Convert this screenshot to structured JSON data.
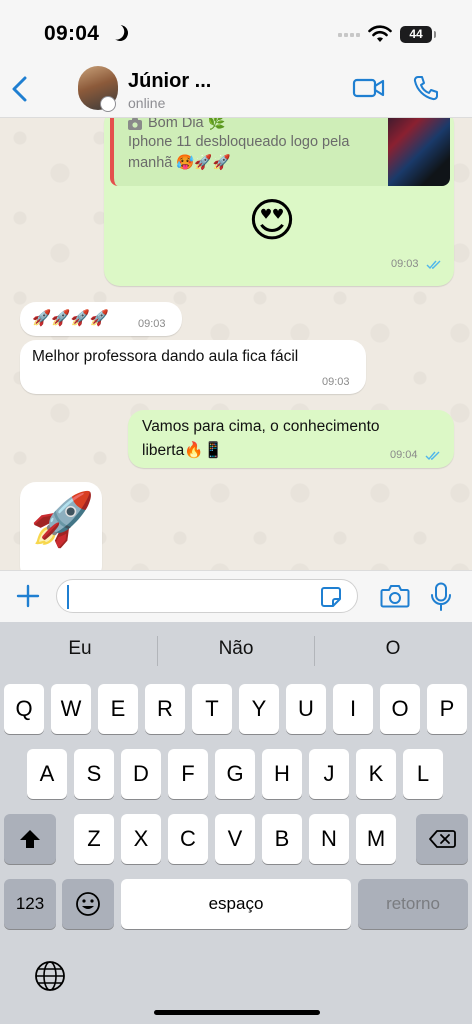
{
  "status_bar": {
    "time": "09:04",
    "battery": "44"
  },
  "header": {
    "contact_name": "Júnior ...",
    "contact_status": "online"
  },
  "messages": {
    "reply": {
      "line1": "Bom Dia 🌿",
      "line2": "Iphone 11 desbloqueado logo pela",
      "line3": "manhã 🥵🚀🚀"
    },
    "m1": {
      "emoji": "😍",
      "time": "09:03"
    },
    "m2": {
      "text": "🚀🚀🚀🚀",
      "time": "09:03"
    },
    "m3": {
      "text": "Melhor professora dando aula fica fácil",
      "time": "09:03"
    },
    "m4": {
      "line1": "Vamos para cima, o conhecimento",
      "line2": "liberta🔥📱",
      "time": "09:04"
    },
    "m5": {
      "emoji": "🚀"
    }
  },
  "keyboard": {
    "suggestions": [
      "Eu",
      "Não",
      "O"
    ],
    "row1": [
      "Q",
      "W",
      "E",
      "R",
      "T",
      "Y",
      "U",
      "I",
      "O",
      "P"
    ],
    "row2": [
      "A",
      "S",
      "D",
      "F",
      "G",
      "H",
      "J",
      "K",
      "L"
    ],
    "row3": [
      "Z",
      "X",
      "C",
      "V",
      "B",
      "N",
      "M"
    ],
    "numbers_label": "123",
    "space_label": "espaço",
    "return_label": "retorno"
  },
  "colors": {
    "accent": "#1f7fd1",
    "outgoing": "#dcf8c6",
    "incoming": "#ffffff",
    "chat_bg": "#efeae2"
  }
}
